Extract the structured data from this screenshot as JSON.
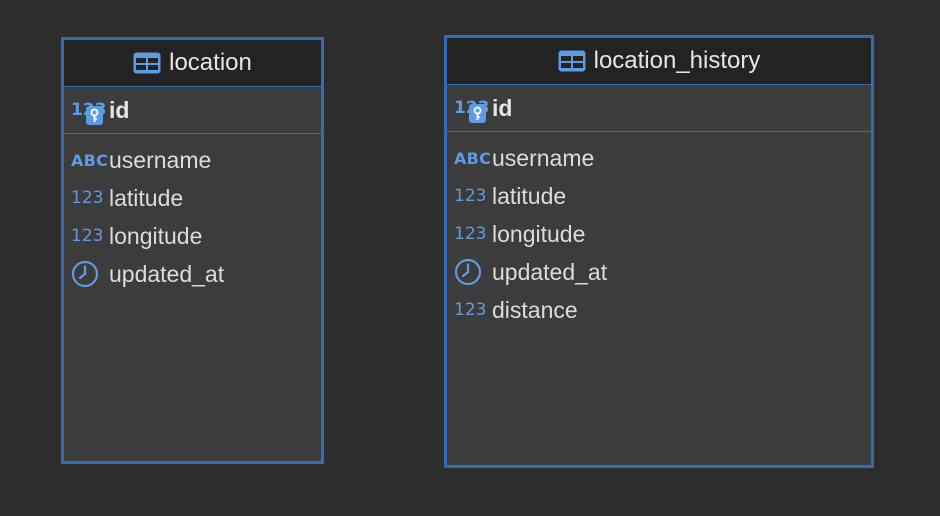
{
  "colors": {
    "background": "#2d2d2d",
    "card": "#3c3c3c",
    "header": "#232323",
    "accent": "#2f6db5",
    "icon": "#5f9be0",
    "text": "#dcdcdc"
  },
  "tables": [
    {
      "name": "location",
      "icon": "table-icon",
      "primary_key": {
        "name": "id",
        "type_label": "123",
        "icon": "key-icon"
      },
      "columns": [
        {
          "name": "username",
          "type_label": "ABC",
          "icon": "text-type-icon"
        },
        {
          "name": "latitude",
          "type_label": "123",
          "icon": "number-type-icon"
        },
        {
          "name": "longitude",
          "type_label": "123",
          "icon": "number-type-icon"
        },
        {
          "name": "updated_at",
          "type_label": "",
          "icon": "clock-icon"
        }
      ]
    },
    {
      "name": "location_history",
      "icon": "table-icon",
      "primary_key": {
        "name": "id",
        "type_label": "123",
        "icon": "key-icon"
      },
      "columns": [
        {
          "name": "username",
          "type_label": "ABC",
          "icon": "text-type-icon"
        },
        {
          "name": "latitude",
          "type_label": "123",
          "icon": "number-type-icon"
        },
        {
          "name": "longitude",
          "type_label": "123",
          "icon": "number-type-icon"
        },
        {
          "name": "updated_at",
          "type_label": "",
          "icon": "clock-icon"
        },
        {
          "name": "distance",
          "type_label": "123",
          "icon": "number-type-icon"
        }
      ]
    }
  ]
}
